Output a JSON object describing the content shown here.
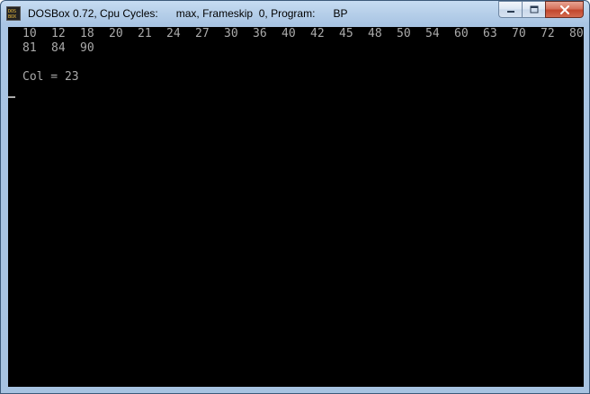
{
  "window": {
    "title": "DOSBox 0.72, Cpu Cycles:      max, Frameskip  0, Program:      BP"
  },
  "icons": {
    "app": "dosbox-icon",
    "minimize": "minimize-icon",
    "maximize": "maximize-icon",
    "close": "close-icon"
  },
  "colors": {
    "screen_bg": "#000000",
    "text": "#aaaaaa",
    "close_button": "#c9462c"
  },
  "console": {
    "row1": [
      "10",
      "12",
      "18",
      "20",
      "21",
      "24",
      "27",
      "30",
      "36",
      "40",
      "42",
      "45",
      "48",
      "50",
      "54",
      "60",
      "63",
      "70",
      "72",
      "80"
    ],
    "row2": [
      "81",
      "84",
      "90"
    ],
    "result": "Col = 23"
  }
}
